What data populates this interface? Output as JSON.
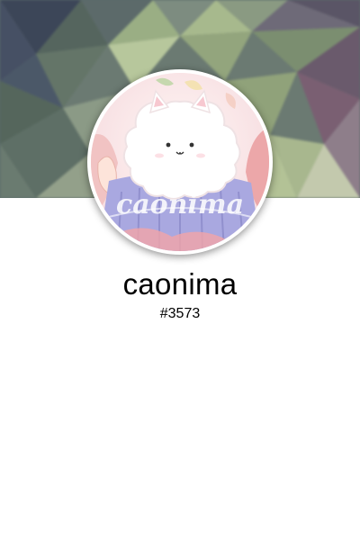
{
  "profile": {
    "username": "caonima",
    "tag": "#3573"
  },
  "banner": {
    "description": "low-poly geometric background",
    "colors": {
      "dark_slate": "#3e4a5a",
      "sage_green": "#8fa37a",
      "pale_green": "#c9d4a8",
      "mauve": "#7a5f72"
    }
  },
  "avatar": {
    "icon": "fluffy-white-cat-avatar",
    "ring_color": "#ffffff",
    "overlay_text": "caonima"
  }
}
